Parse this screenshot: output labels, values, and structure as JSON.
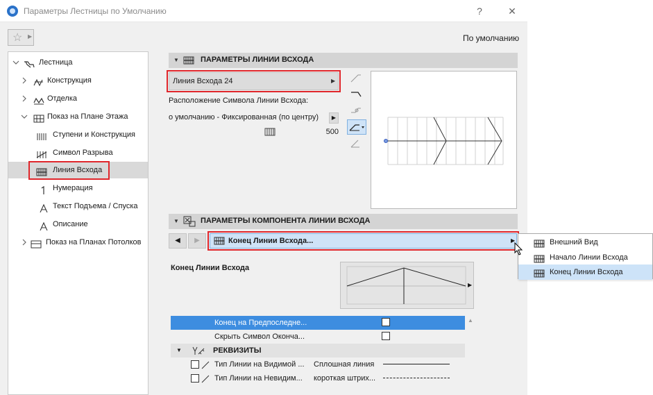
{
  "window": {
    "title": "Параметры Лестницы по Умолчанию",
    "help_glyph": "?",
    "close_glyph": "✕"
  },
  "toolbar": {
    "favorites_glyph": "☆",
    "favorites_arrow": "▶",
    "default_label": "По умолчанию"
  },
  "tree": {
    "items": [
      {
        "label": "Лестница",
        "icon": "stair-icon",
        "expander": "v"
      },
      {
        "label": "Конструкция",
        "icon": "structure-icon",
        "expander": ">"
      },
      {
        "label": "Отделка",
        "icon": "finish-icon",
        "expander": ">"
      },
      {
        "label": "Показ на Плане Этажа",
        "icon": "floorplan-icon",
        "expander": "v"
      },
      {
        "label": "Ступени и Конструкция",
        "icon": "treads-icon",
        "expander": ""
      },
      {
        "label": "Символ Разрыва",
        "icon": "break-symbol-icon",
        "expander": ""
      },
      {
        "label": "Линия Всхода",
        "icon": "walking-line-icon",
        "expander": ""
      },
      {
        "label": "Нумерация",
        "icon": "numbering-icon",
        "expander": ""
      },
      {
        "label": "Текст Подъема / Спуска",
        "icon": "up-down-text-icon",
        "expander": ""
      },
      {
        "label": "Описание",
        "icon": "description-icon",
        "expander": ""
      },
      {
        "label": "Показ на Планах Потолков",
        "icon": "ceiling-plan-icon",
        "expander": ">"
      }
    ]
  },
  "walking_line_section": {
    "title": "ПАРАМЕТРЫ ЛИНИИ ВСХОДА",
    "type_button": "Линия Всхода 24",
    "type_arrow": "▶",
    "position_label": "Расположение Символа Линии Всхода:",
    "position_value": "о умолчанию - Фиксированная (по центру)",
    "position_arrow": "▶",
    "offset_value": "500"
  },
  "component_section": {
    "title": "ПАРАМЕТРЫ КОМПОНЕНТА ЛИНИИ ВСХОДА",
    "prev_glyph": "◀",
    "next_glyph": "▶",
    "component_button": "Конец Линии Всхода...",
    "component_arrow": "▶",
    "subtitle": "Конец Линии Всхода",
    "preview_arrow": "▶"
  },
  "component_menu": {
    "items": [
      {
        "label": "Внешний Вид",
        "selected": false
      },
      {
        "label": "Начало Линии Всхода",
        "selected": false
      },
      {
        "label": "Конец Линии Всхода",
        "selected": true
      }
    ]
  },
  "settings_table": {
    "rows": [
      {
        "label": "Конец на Предпоследне...",
        "checked": false,
        "selected": true
      },
      {
        "label": "Скрыть Символ Оконча...",
        "checked": false,
        "selected": false
      }
    ],
    "group_label": "РЕКВИЗИТЫ",
    "group_toggle": "▼",
    "attribute_rows": [
      {
        "label": "Тип Линии на Видимой ...",
        "value": "Сплошная линия",
        "line_style": "solid"
      },
      {
        "label": "Тип Линии на Невидим...",
        "value": "короткая штрих...",
        "line_style": "dashed"
      }
    ],
    "scroll_up_glyph": "▲"
  },
  "colors": {
    "highlight_red": "#e0262b",
    "selection_blue": "#3d8de0",
    "menu_selection": "#cde3f8",
    "component_button_bg": "#cfe3f7"
  }
}
